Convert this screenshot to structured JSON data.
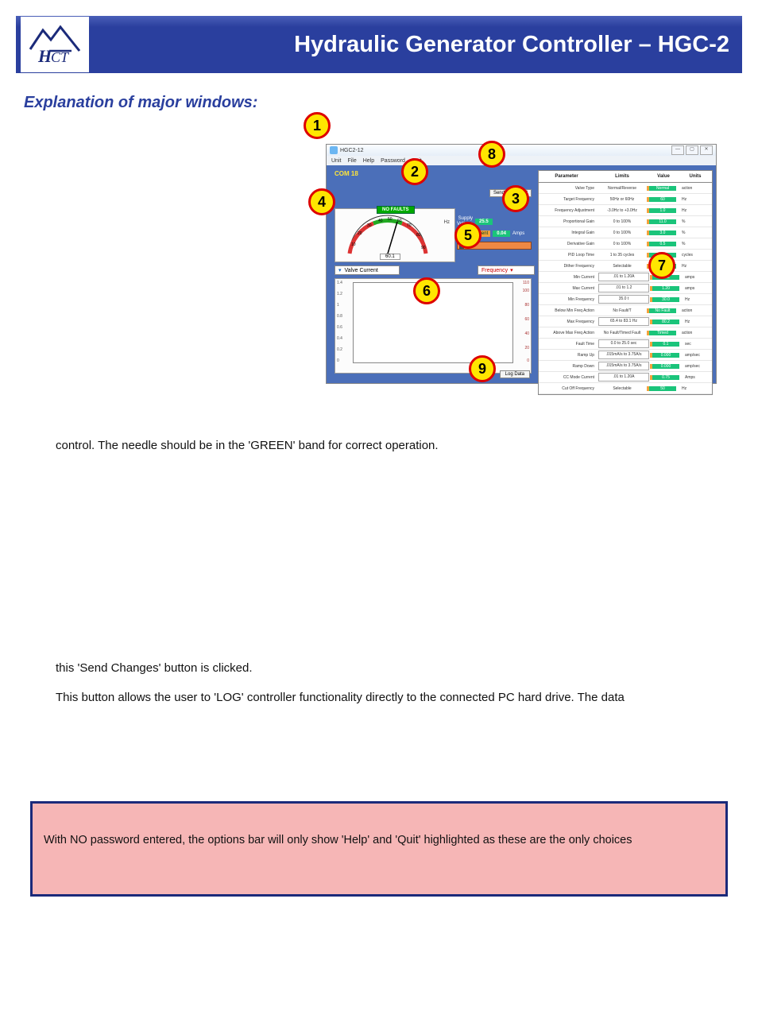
{
  "header": {
    "title": "Hydraulic Generator Controller – HGC-2",
    "logo_text": "HCT"
  },
  "section_heading": "Explanation of major windows:",
  "app": {
    "window_title": "HGC2-12",
    "menu": [
      "Unit",
      "File",
      "Help",
      "Password",
      "Quit"
    ],
    "com_label": "COM 18",
    "no_faults": "NO FAULTS",
    "hz_label": "Hz",
    "gauge_value": "60.1",
    "supply_label": "Supply\nVoltage",
    "supply_value": "25.5",
    "valve_current_label": "Valve Current",
    "valve_current_value": "0.04",
    "valve_current_unit": "Amps",
    "send_changes": "Send Changes?",
    "left_dropdown": "Valve Current",
    "right_dropdown": "Frequency",
    "log_button": "Log  Data",
    "chart_y_left": [
      "1.4",
      "1.2",
      "1",
      "0.8",
      "0.6",
      "0.4",
      "0.2",
      "0"
    ],
    "chart_y_right": [
      "110",
      "100",
      "80",
      "60",
      "40",
      "20",
      "0"
    ],
    "table_headers": {
      "parameter": "Parameter",
      "limits": "Limits",
      "value": "Value",
      "units": "Units"
    },
    "parameters": [
      {
        "p": "Valve Type",
        "l": "Normal/Reverse",
        "v": "Normal",
        "u": "action"
      },
      {
        "p": "Target Frequency",
        "l": "50Hz or 60Hz",
        "v": "60",
        "u": "Hz"
      },
      {
        "p": "Frequency Adjustment",
        "l": "-3.0Hz to +3.0Hz",
        "v": "1.0",
        "u": "Hz"
      },
      {
        "p": "Proportional Gain",
        "l": "0 to 100%",
        "v": "11.0",
        "u": "%"
      },
      {
        "p": "Integral Gain",
        "l": "0 to 100%",
        "v": "3.0",
        "u": "%"
      },
      {
        "p": "Derivative Gain",
        "l": "0 to 100%",
        "v": "0.5",
        "u": "%"
      },
      {
        "p": "PID Loop Time",
        "l": "1 to 35 cycles",
        "v": "8",
        "u": "cycles"
      },
      {
        "p": "Dither Frequency",
        "l": "Selectable",
        "v": "125",
        "u": "Hz"
      },
      {
        "p": "Min Current",
        "l": ".01 to 1.20A",
        "v": "0.12",
        "u": "amps",
        "box": true
      },
      {
        "p": "Max Current",
        "l": ".01 to 1.2",
        "v": "1.20",
        "u": "amps",
        "box": true
      },
      {
        "p": "Min Frequency",
        "l": "35.0 t",
        "v": "30.0",
        "u": "Hz",
        "box": true
      },
      {
        "p": "Below Min Freq Action",
        "l": "No Fault/T",
        "v": "No Fault",
        "u": "action"
      },
      {
        "p": "Max Frequency",
        "l": "65.4 to 83.1 Hz",
        "v": "80.2",
        "u": "Hz",
        "box": true
      },
      {
        "p": "Above Max Freq Action",
        "l": "No Fault/Timed Fault",
        "v": "Timed",
        "u": "action"
      },
      {
        "p": "Fault Time",
        "l": "0.0 to 25.0 sec",
        "v": "0.1",
        "u": "sec",
        "box": true
      },
      {
        "p": "Ramp Up",
        "l": ".015mA/s to 3.75A/s",
        "v": "0.000",
        "u": "amp/sec",
        "box": true
      },
      {
        "p": "Ramp Down",
        "l": ".015mA/s to 3.75A/s",
        "v": "0.000",
        "u": "amp/sec",
        "box": true
      },
      {
        "p": "CC Mode Current",
        "l": ".01 to 1.20A",
        "v": "0.75",
        "u": "Amps",
        "box": true
      },
      {
        "p": "Cut Off Frequency",
        "l": "Selectable",
        "v": "50",
        "u": "Hz"
      }
    ]
  },
  "callouts": [
    "1",
    "2",
    "3",
    "4",
    "5",
    "6",
    "7",
    "8",
    "9"
  ],
  "body": {
    "p1": "control. The needle should be in the 'GREEN' band for correct operation.",
    "p2": "this 'Send Changes' button is clicked.",
    "p3": "This button allows the user to 'LOG' controller functionality directly to the connected PC hard drive. The data"
  },
  "note": "With NO password entered, the options bar will only show 'Help' and 'Quit' highlighted as these are the only choices"
}
